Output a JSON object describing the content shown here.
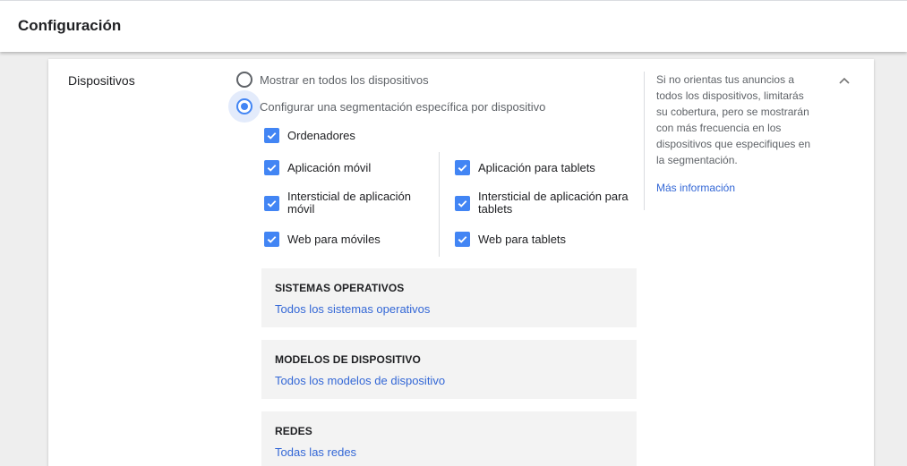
{
  "header": {
    "title": "Configuración"
  },
  "section": {
    "label": "Dispositivos",
    "radio_options": [
      {
        "label": "Mostrar en todos los dispositivos",
        "selected": false
      },
      {
        "label": "Configurar una segmentación específica por dispositivo",
        "selected": true
      }
    ],
    "checkboxes": {
      "desktop": {
        "label": "Ordenadores",
        "checked": true
      },
      "mobile": [
        {
          "label": "Aplicación móvil",
          "checked": true
        },
        {
          "label": "Intersticial de aplicación móvil",
          "checked": true
        },
        {
          "label": "Web para móviles",
          "checked": true
        }
      ],
      "tablet": [
        {
          "label": "Aplicación para tablets",
          "checked": true
        },
        {
          "label": "Intersticial de aplicación para tablets",
          "checked": true
        },
        {
          "label": "Web para tablets",
          "checked": true
        }
      ]
    },
    "panels": [
      {
        "title": "SISTEMAS OPERATIVOS",
        "link": "Todos los sistemas operativos"
      },
      {
        "title": "MODELOS DE DISPOSITIVO",
        "link": "Todos los modelos de dispositivo"
      },
      {
        "title": "REDES",
        "link": "Todas las redes"
      }
    ],
    "help": {
      "text": "Si no orientas tus anuncios a todos los dispositivos, limitarás su cobertura, pero se mostrarán con más frecuencia en los dispositivos que especifiques en la segmentación.",
      "link": "Más información"
    },
    "collapse_icon": "chevron-up-icon"
  },
  "colors": {
    "accent": "#4285f4",
    "link": "#3367d6",
    "panel_bg": "#f3f3f3"
  }
}
